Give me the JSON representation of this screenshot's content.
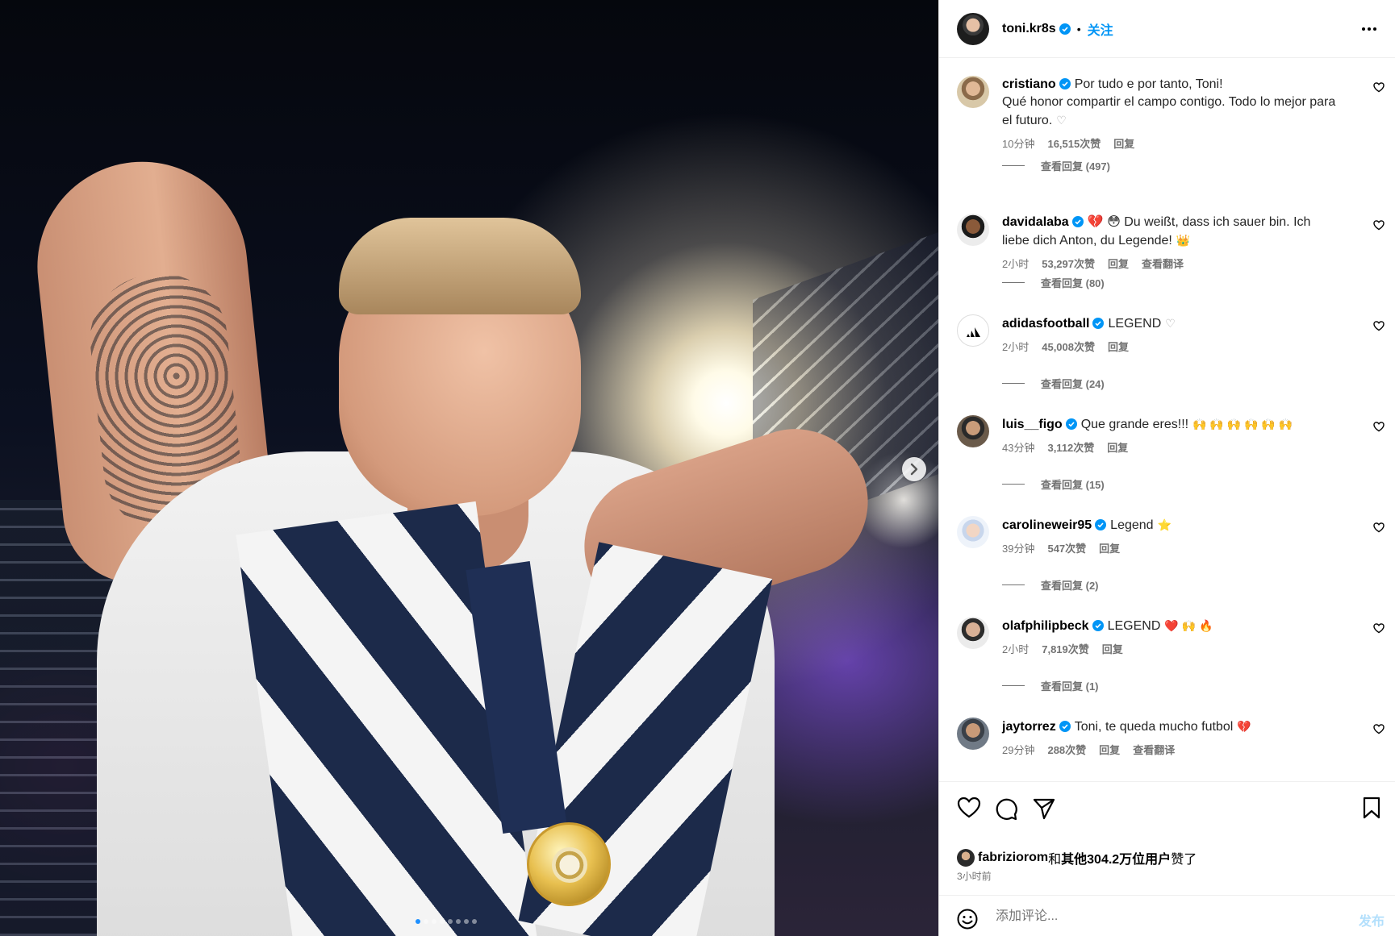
{
  "post": {
    "author": "toni.kr8s",
    "separator": "•",
    "follow_label": "关注",
    "more_icon": "more-horizontal-icon",
    "verified_color": "#0095f6"
  },
  "comments": [
    {
      "user": "cristiano",
      "line1": "Por tudo e por tanto, Toni!",
      "line2": "Qué honor compartir el campo contigo. Todo lo mejor para el futuro.",
      "emoji": "♡",
      "time": "10分钟",
      "likes": "16,515次赞",
      "reply": "回复",
      "translate": "",
      "view_replies": "查看回复 (497)"
    },
    {
      "user": "davidalaba",
      "line1": "💔 😳 Du weißt, dass ich sauer bin. Ich liebe dich Anton, du Legende!",
      "line2": "",
      "emoji": "👑",
      "time": "2小时",
      "likes": "53,297次赞",
      "reply": "回复",
      "translate": "查看翻译",
      "view_replies": "查看回复 (80)"
    },
    {
      "user": "adidasfootball",
      "line1": "LEGEND",
      "line2": "",
      "emoji": "♡",
      "time": "2小时",
      "likes": "45,008次赞",
      "reply": "回复",
      "translate": "",
      "view_replies": "查看回复 (24)"
    },
    {
      "user": "luis__figo",
      "line1": "Que grande eres!!!",
      "line2": "",
      "emoji": "🙌 🙌 🙌 🙌 🙌 🙌",
      "time": "43分钟",
      "likes": "3,112次赞",
      "reply": "回复",
      "translate": "",
      "view_replies": "查看回复 (15)"
    },
    {
      "user": "carolineweir95",
      "line1": "Legend",
      "line2": "",
      "emoji": "⭐",
      "time": "39分钟",
      "likes": "547次赞",
      "reply": "回复",
      "translate": "",
      "view_replies": "查看回复 (2)"
    },
    {
      "user": "olafphilipbeck",
      "line1": "LEGEND",
      "line2": "",
      "emoji": "❤️ 🙌 🔥",
      "time": "2小时",
      "likes": "7,819次赞",
      "reply": "回复",
      "translate": "",
      "view_replies": "查看回复 (1)"
    },
    {
      "user": "jaytorrez",
      "line1": "Toni, te queda mucho futbol",
      "line2": "",
      "emoji": "💔",
      "time": "29分钟",
      "likes": "288次赞",
      "reply": "回复",
      "translate": "查看翻译",
      "view_replies": ""
    }
  ],
  "actions": {
    "like_icon": "heart-icon",
    "comment_icon": "comment-icon",
    "share_icon": "send-icon",
    "save_icon": "bookmark-icon"
  },
  "likes_summary": {
    "user": "fabriziorom",
    "and": "和",
    "others": "其他304.2万位用户",
    "suffix": "赞了"
  },
  "post_time": "3小时前",
  "add_comment": {
    "placeholder": "添加评论...",
    "post_label": "发布",
    "post_color": "#b2dffc"
  },
  "carousel": {
    "total_slides": 8,
    "active_slide": 1
  }
}
